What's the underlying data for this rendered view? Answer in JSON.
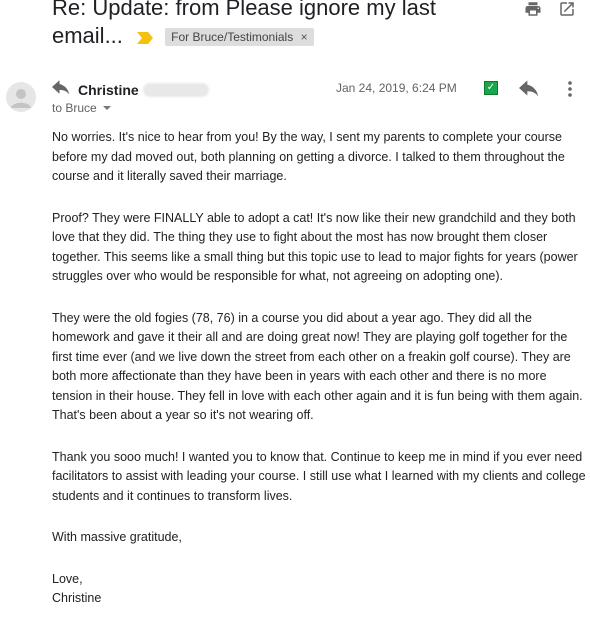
{
  "email": {
    "subject": "Re: Update: from Please ignore my last email...",
    "label": "For Bruce/Testimonials",
    "label_close": "×",
    "sender_name": "Christine",
    "recipient": "to Bruce",
    "date": "Jan 24, 2019, 6:24 PM",
    "body": {
      "p1": "No worries. It's nice to hear from you! By the way, I sent my parents to complete your course before my dad moved out, both planning on getting a divorce.  I talked to them throughout the course and it literally saved their marriage.",
      "p2": "Proof? They were FINALLY able to adopt a cat! It's now like their new grandchild and they both love that they did. The thing they use to fight about the most has now brought them closer together. This seems like a small thing but this topic use to lead to major fights for years (power struggles over who would be responsible for what, not agreeing on adopting one).",
      "p3": "They were the old fogies (78, 76) in a course you did about a year ago. They did all the homework and gave it their all and are doing great now! They are playing golf together for the first time ever (and we live down the street from each other on a freakin golf course). They are both more affectionate than they have been in years with each other and there is no more tension in their house. They fell in love with each other again and it is fun being with them again. That's been about a year so it's not wearing off.",
      "p4": "Thank you sooo much! I wanted you to know that. Continue to keep me in mind if you ever need facilitators to assist with leading your course. I still use what I learned with my clients and college students and it continues to transform lives.",
      "p5": "With massive gratitude,",
      "closing": "Love,",
      "signature": "Christine"
    }
  },
  "icons": {
    "print": "print-icon",
    "open_new_window": "open-in-new-window-icon",
    "importance": "importance-marker-icon",
    "avatar": "person-avatar-icon",
    "reply_small": "reply-arrow-icon",
    "reply": "reply-icon",
    "more": "more-vert-icon",
    "checkbox": "green-check-icon"
  },
  "colors": {
    "importance": "#f4c20d",
    "label_bg": "#dddddd",
    "green": "#1aa64a"
  }
}
